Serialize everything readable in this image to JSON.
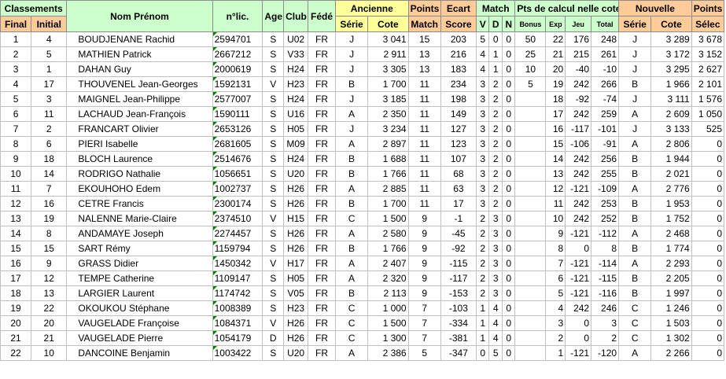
{
  "headers": {
    "classements": "Classements",
    "final": "Final",
    "initial": "Initial",
    "nom_prenom": "Nom Prénom",
    "nlic": "n°lic.",
    "age": "Age",
    "club": "Club",
    "fede": "Fédé",
    "ancienne": "Ancienne",
    "serie_old": "Série",
    "cote_old": "Cote",
    "points_match_1": "Points",
    "points_match_2": "Match",
    "ecart_score_1": "Ecart",
    "ecart_score_2": "Score",
    "match": "Match",
    "v": "V",
    "d": "D",
    "n": "N",
    "pts_calcul": "Pts de calcul nelle cote",
    "bonus": "Bonus",
    "exp": "Exp",
    "jeu": "Jeu",
    "total": "Total",
    "nouvelle": "Nouvelle",
    "serie_new": "Série",
    "cote_new": "Cote",
    "points_selec_1": "Points",
    "points_selec_2": "Sélec"
  },
  "rows": [
    [
      "1",
      "4",
      "BOUDJENANE Rachid",
      "2594701",
      "S",
      "U02",
      "FR",
      "J",
      "3 041",
      "15",
      "203",
      "5",
      "0",
      "0",
      "50",
      "22",
      "176",
      "248",
      "J",
      "3 289",
      "3 678"
    ],
    [
      "2",
      "5",
      "MATHIEN Patrick",
      "2667212",
      "S",
      "V33",
      "FR",
      "J",
      "2 911",
      "13",
      "216",
      "4",
      "1",
      "0",
      "25",
      "21",
      "215",
      "261",
      "J",
      "3 172",
      "3 152"
    ],
    [
      "3",
      "1",
      "DAHAN Guy",
      "2000619",
      "S",
      "H24",
      "FR",
      "J",
      "3 305",
      "13",
      "183",
      "4",
      "1",
      "0",
      "10",
      "20",
      "-40",
      "-10",
      "J",
      "3 295",
      "2 627"
    ],
    [
      "4",
      "17",
      "THOUVENEL Jean-Georges",
      "1592131",
      "V",
      "H23",
      "FR",
      "B",
      "1 700",
      "11",
      "234",
      "3",
      "2",
      "0",
      "5",
      "19",
      "242",
      "266",
      "B",
      "1 966",
      "2 101"
    ],
    [
      "5",
      "3",
      "MAIGNEL Jean-Philippe",
      "2577007",
      "S",
      "H24",
      "FR",
      "J",
      "3 185",
      "11",
      "198",
      "3",
      "2",
      "0",
      "",
      "18",
      "-92",
      "-74",
      "J",
      "3 111",
      "1 576"
    ],
    [
      "6",
      "11",
      "LACHAUD Jean-François",
      "1590111",
      "S",
      "U16",
      "FR",
      "A",
      "2 350",
      "11",
      "149",
      "3",
      "2",
      "0",
      "",
      "17",
      "242",
      "259",
      "A",
      "2 609",
      "1 050"
    ],
    [
      "7",
      "2",
      "FRANCART Olivier",
      "2653126",
      "S",
      "H05",
      "FR",
      "J",
      "3 234",
      "11",
      "127",
      "3",
      "2",
      "0",
      "",
      "16",
      "-117",
      "-101",
      "J",
      "3 133",
      "525"
    ],
    [
      "8",
      "6",
      "PIERI Isabelle",
      "2681605",
      "S",
      "M09",
      "FR",
      "A",
      "2 897",
      "11",
      "123",
      "3",
      "2",
      "0",
      "",
      "15",
      "-106",
      "-91",
      "A",
      "2 806",
      "0"
    ],
    [
      "9",
      "18",
      "BLOCH Laurence",
      "2514676",
      "S",
      "H24",
      "FR",
      "B",
      "1 688",
      "11",
      "107",
      "3",
      "2",
      "0",
      "",
      "14",
      "242",
      "256",
      "B",
      "1 944",
      "0"
    ],
    [
      "10",
      "14",
      "RODRIGO Nathalie",
      "1056651",
      "S",
      "U20",
      "FR",
      "B",
      "1 766",
      "11",
      "68",
      "3",
      "2",
      "0",
      "",
      "13",
      "242",
      "255",
      "B",
      "2 021",
      "0"
    ],
    [
      "11",
      "7",
      "EKOUHOHO Edem",
      "1002737",
      "S",
      "H26",
      "FR",
      "A",
      "2 885",
      "11",
      "63",
      "3",
      "2",
      "0",
      "",
      "12",
      "-121",
      "-109",
      "A",
      "2 776",
      "0"
    ],
    [
      "12",
      "16",
      "CETRE Francis",
      "2300174",
      "S",
      "H26",
      "FR",
      "B",
      "1 700",
      "11",
      "17",
      "3",
      "2",
      "0",
      "",
      "11",
      "242",
      "253",
      "B",
      "1 953",
      "0"
    ],
    [
      "13",
      "19",
      "NALENNE Marie-Claire",
      "2374510",
      "V",
      "H15",
      "FR",
      "C",
      "1 500",
      "9",
      "-1",
      "2",
      "3",
      "0",
      "",
      "10",
      "242",
      "252",
      "B",
      "1 752",
      "0"
    ],
    [
      "14",
      "8",
      "ANDAMAYE Joseph",
      "2274457",
      "S",
      "H26",
      "FR",
      "A",
      "2 580",
      "9",
      "-45",
      "2",
      "3",
      "0",
      "",
      "9",
      "-121",
      "-112",
      "A",
      "2 468",
      "0"
    ],
    [
      "15",
      "15",
      "SART Rémy",
      "1159794",
      "S",
      "H26",
      "FR",
      "B",
      "1 766",
      "9",
      "-92",
      "2",
      "3",
      "0",
      "",
      "8",
      "0",
      "8",
      "B",
      "1 774",
      "0"
    ],
    [
      "16",
      "9",
      "GRASS Didier",
      "1450342",
      "V",
      "H17",
      "FR",
      "A",
      "2 407",
      "9",
      "-115",
      "2",
      "3",
      "0",
      "",
      "7",
      "-121",
      "-114",
      "A",
      "2 293",
      "0"
    ],
    [
      "17",
      "12",
      "TEMPE Catherine",
      "1109147",
      "S",
      "H05",
      "FR",
      "A",
      "2 320",
      "9",
      "-117",
      "2",
      "3",
      "0",
      "",
      "6",
      "-121",
      "-115",
      "B",
      "2 205",
      "0"
    ],
    [
      "18",
      "13",
      "LARGIER Laurent",
      "1174742",
      "S",
      "V05",
      "FR",
      "B",
      "2 113",
      "9",
      "-153",
      "2",
      "3",
      "0",
      "",
      "5",
      "-121",
      "-116",
      "B",
      "1 997",
      "0"
    ],
    [
      "19",
      "22",
      "OKOUKOU Stéphane",
      "1008389",
      "S",
      "H23",
      "FR",
      "C",
      "1 000",
      "7",
      "-103",
      "1",
      "4",
      "0",
      "",
      "4",
      "242",
      "246",
      "C",
      "1 246",
      "0"
    ],
    [
      "20",
      "20",
      "VAUGELADE Françoise",
      "1084371",
      "V",
      "H26",
      "FR",
      "C",
      "1 500",
      "7",
      "-334",
      "1",
      "4",
      "0",
      "",
      "3",
      "0",
      "3",
      "C",
      "1 503",
      "0"
    ],
    [
      "21",
      "21",
      "VAUGELADE Pierre",
      "1054179",
      "D",
      "H26",
      "FR",
      "C",
      "1 300",
      "7",
      "-381",
      "1",
      "4",
      "0",
      "",
      "2",
      "0",
      "2",
      "C",
      "1 302",
      "0"
    ],
    [
      "22",
      "10",
      "DANCOINE Benjamin",
      "1003422",
      "S",
      "U20",
      "FR",
      "A",
      "2 386",
      "5",
      "-347",
      "0",
      "5",
      "0",
      "",
      "1",
      "-121",
      "-120",
      "A",
      "2 266",
      "0"
    ]
  ],
  "colors": {
    "header_green": "#ccffcc",
    "header_orange": "#ffcc99",
    "header_yellow": "#ffff99",
    "dashed_border": "#33aa33"
  }
}
